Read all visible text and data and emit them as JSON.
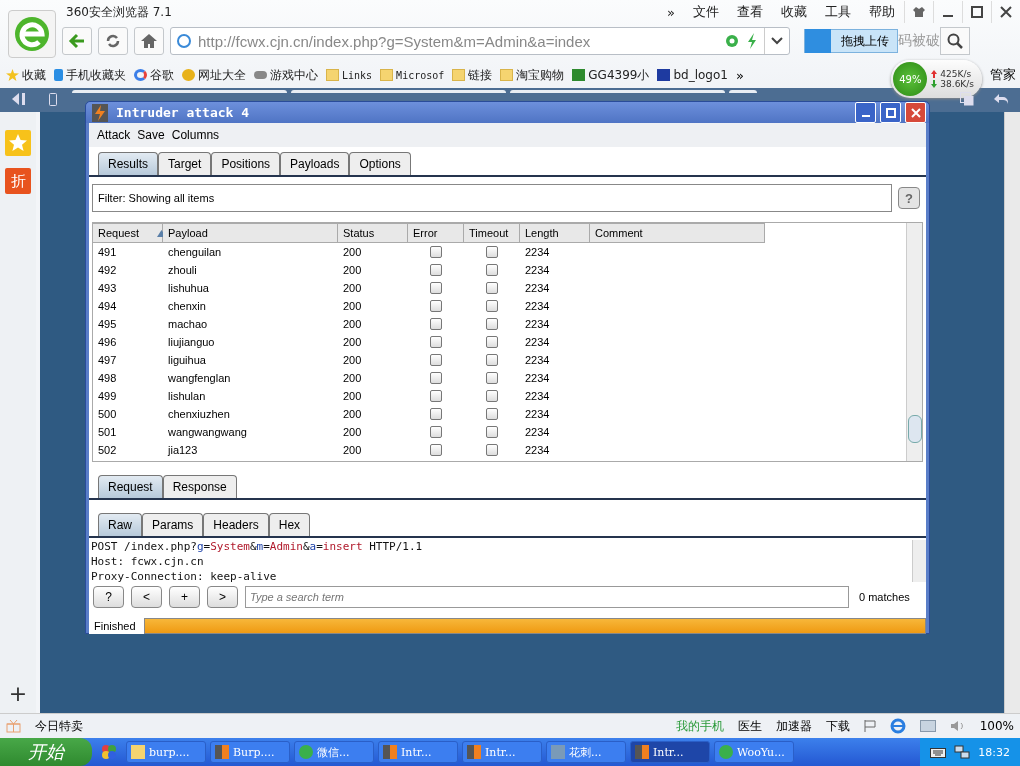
{
  "browser": {
    "title": "360安全浏览器 7.1",
    "menu": [
      "»",
      "文件",
      "查看",
      "收藏",
      "工具",
      "帮助"
    ],
    "url": "http://fcwx.cjn.cn/index.php?g=System&m=Admin&a=index",
    "upload_button": "拖拽上传",
    "search_partial": "码被破",
    "bookmarks": [
      {
        "label": "收藏",
        "kind": "star"
      },
      {
        "label": "手机收藏夹",
        "kind": "phone"
      },
      {
        "label": "谷歌",
        "kind": "g"
      },
      {
        "label": "网址大全",
        "kind": "plus"
      },
      {
        "label": "游戏中心",
        "kind": "game"
      },
      {
        "label": "Links",
        "kind": "folder"
      },
      {
        "label": "Microsof",
        "kind": "folder"
      },
      {
        "label": "链接",
        "kind": "folder"
      },
      {
        "label": "淘宝购物",
        "kind": "folder"
      },
      {
        "label": "GG4399小",
        "kind": "grid"
      },
      {
        "label": "bd_logo1",
        "kind": "paw"
      }
    ],
    "more": "»",
    "speed": {
      "percent": "49%",
      "up": "425K/s",
      "down": "38.6K/s"
    },
    "manager": "管家",
    "side_badge": "折",
    "add": "+"
  },
  "window": {
    "title": "Intruder attack 4",
    "menu": [
      "Attack",
      "Save",
      "Columns"
    ],
    "tabs": [
      {
        "label": "Results",
        "selected": true
      },
      {
        "label": "Target",
        "selected": false
      },
      {
        "label": "Positions",
        "selected": false
      },
      {
        "label": "Payloads",
        "selected": false
      },
      {
        "label": "Options",
        "selected": false
      }
    ],
    "filter": "Filter:  Showing all items",
    "help": "?",
    "table": {
      "columns": [
        "Request",
        "Payload",
        "Status",
        "Error",
        "Timeout",
        "Length",
        "Comment"
      ],
      "rows": [
        {
          "request": "491",
          "payload": "chenguilan",
          "status": "200",
          "error": false,
          "timeout": false,
          "length": "2234"
        },
        {
          "request": "492",
          "payload": "zhouli",
          "status": "200",
          "error": false,
          "timeout": false,
          "length": "2234"
        },
        {
          "request": "493",
          "payload": "lishuhua",
          "status": "200",
          "error": false,
          "timeout": false,
          "length": "2234"
        },
        {
          "request": "494",
          "payload": "chenxin",
          "status": "200",
          "error": false,
          "timeout": false,
          "length": "2234"
        },
        {
          "request": "495",
          "payload": "machao",
          "status": "200",
          "error": false,
          "timeout": false,
          "length": "2234"
        },
        {
          "request": "496",
          "payload": "liujianguo",
          "status": "200",
          "error": false,
          "timeout": false,
          "length": "2234"
        },
        {
          "request": "497",
          "payload": "liguihua",
          "status": "200",
          "error": false,
          "timeout": false,
          "length": "2234"
        },
        {
          "request": "498",
          "payload": "wangfenglan",
          "status": "200",
          "error": false,
          "timeout": false,
          "length": "2234"
        },
        {
          "request": "499",
          "payload": "lishulan",
          "status": "200",
          "error": false,
          "timeout": false,
          "length": "2234"
        },
        {
          "request": "500",
          "payload": "chenxiuzhen",
          "status": "200",
          "error": false,
          "timeout": false,
          "length": "2234"
        },
        {
          "request": "501",
          "payload": "wangwangwang",
          "status": "200",
          "error": false,
          "timeout": false,
          "length": "2234"
        },
        {
          "request": "502",
          "payload": "jia123",
          "status": "200",
          "error": false,
          "timeout": false,
          "length": "2234"
        }
      ]
    },
    "message_tabs": [
      {
        "label": "Request",
        "selected": true
      },
      {
        "label": "Response",
        "selected": false
      }
    ],
    "view_tabs": [
      {
        "label": "Raw",
        "selected": true
      },
      {
        "label": "Params",
        "selected": false
      },
      {
        "label": "Headers",
        "selected": false
      },
      {
        "label": "Hex",
        "selected": false
      }
    ],
    "raw_lines": [
      [
        {
          "text": "POST /index.php?",
          "kind": "plain"
        },
        {
          "text": "g",
          "kind": "name"
        },
        {
          "text": "=",
          "kind": "plain"
        },
        {
          "text": "System",
          "kind": "value"
        },
        {
          "text": "&",
          "kind": "plain"
        },
        {
          "text": "m",
          "kind": "name"
        },
        {
          "text": "=",
          "kind": "plain"
        },
        {
          "text": "Admin",
          "kind": "value"
        },
        {
          "text": "&",
          "kind": "plain"
        },
        {
          "text": "a",
          "kind": "name"
        },
        {
          "text": "=",
          "kind": "plain"
        },
        {
          "text": "insert",
          "kind": "value"
        },
        {
          "text": " HTTP/1.1",
          "kind": "plain"
        }
      ],
      [
        {
          "text": "Host: fcwx.cjn.cn",
          "kind": "plain"
        }
      ],
      [
        {
          "text": "Proxy-Connection: keep-alive",
          "kind": "plain"
        }
      ]
    ],
    "search_buttons": [
      "?",
      "<",
      "+",
      ">"
    ],
    "search_placeholder": "Type a search term",
    "matches": "0 matches",
    "status": "Finished",
    "progress": {
      "level": 1
    }
  },
  "status_bar": {
    "left": "今日特卖",
    "items": [
      {
        "label": "我的手机",
        "kind": "phone"
      },
      {
        "label": "医生",
        "kind": "doctor"
      },
      {
        "label": "加速器",
        "kind": "rocket"
      },
      {
        "label": "下载",
        "kind": "download"
      }
    ],
    "zoom": "100%"
  },
  "taskbar": {
    "start": "开始",
    "items": [
      {
        "label": "burp....",
        "kind": "folder",
        "selected": false
      },
      {
        "label": "Burp....",
        "kind": "burp",
        "selected": false
      },
      {
        "label": "微信...",
        "kind": "ie",
        "selected": false
      },
      {
        "label": "Intr...",
        "kind": "burp",
        "selected": false
      },
      {
        "label": "Intr...",
        "kind": "burp",
        "selected": false
      },
      {
        "label": "花刺...",
        "kind": "net",
        "selected": false
      },
      {
        "label": "Intr...",
        "kind": "burp",
        "selected": true
      },
      {
        "label": "WooYu...",
        "kind": "ie",
        "selected": false
      }
    ],
    "clock": "18:32"
  }
}
